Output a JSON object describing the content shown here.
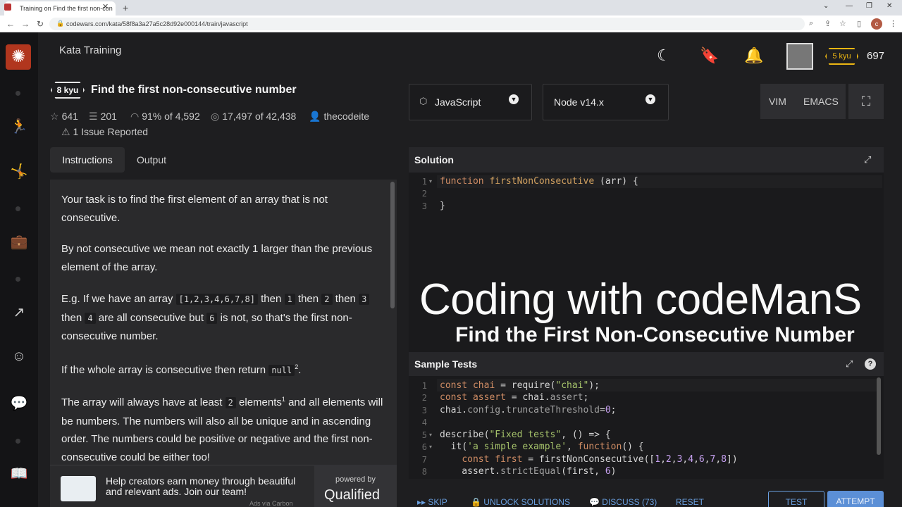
{
  "browser": {
    "tab_title": "Training on Find the first non-con",
    "url": "codewars.com/kata/58f8a3a27a5c28d92e000144/train/javascript",
    "profile_initial": "c"
  },
  "header": {
    "section": "Kata Training",
    "kyu": "5 kyu",
    "honor": "697"
  },
  "kata": {
    "rank": "8 kyu",
    "title": "Find the first non-consecutive number",
    "stars": "641",
    "collections": "201",
    "satisfaction": "91%",
    "satisfaction_of": "of 4,592",
    "completed": "17,497",
    "completed_of": "of 42,438",
    "author": "thecodeite",
    "issues": "1 Issue Reported"
  },
  "tabs": {
    "instructions": "Instructions",
    "output": "Output"
  },
  "instructions": {
    "p1": "Your task is to find the first element of an array that is not consecutive.",
    "p2": "By not consecutive we mean not exactly 1 larger than the previous element of the array.",
    "p3_a": "E.g. If we have an array",
    "p3_code1": "[1,2,3,4,6,7,8]",
    "p3_b": "then",
    "p3_code2": "1",
    "p3_c": "then",
    "p3_code3": "2",
    "p3_d": "then",
    "p3_code4": "3",
    "p3_e": "then",
    "p3_code5": "4",
    "p3_f": "are all consecutive but",
    "p3_code6": "6",
    "p3_g": "is not, so that's the first non-consecutive number.",
    "p4_a": "If the whole array is consecutive then return",
    "p4_code": "null",
    "p4_sup": "2",
    "p4_b": ".",
    "p5_a": "The array will always have at least",
    "p5_code": "2",
    "p5_b": "elements",
    "p5_sup": "1",
    "p5_c": "and all elements will be numbers. The numbers will also all be unique and in ascending order. The numbers could be positive or negative and the first non-consecutive could be either too!"
  },
  "ad": {
    "text": "Help creators earn money through beautiful and relevant ads. Join our team!",
    "carbon": "Ads via Carbon",
    "powered_by": "powered by",
    "brand": "Qualified"
  },
  "toolbar": {
    "language": "JavaScript",
    "runtime": "Node v14.x",
    "vim": "VIM",
    "emacs": "EMACS"
  },
  "solution": {
    "label": "Solution",
    "lines": [
      {
        "n": "1",
        "kw": "function",
        "fn": "firstNonConsecutive",
        "rest": " (arr) {"
      },
      {
        "n": "2",
        "text": ""
      },
      {
        "n": "3",
        "text": "}"
      }
    ]
  },
  "overlay": {
    "main": "Coding with codeManS",
    "sub": "Find the First Non-Consecutive Number"
  },
  "tests": {
    "label": "Sample Tests",
    "line_numbers": [
      "1",
      "2",
      "3",
      "4",
      "5",
      "6",
      "7",
      "8"
    ]
  },
  "bottom": {
    "skip": "SKIP",
    "unlock": "UNLOCK SOLUTIONS",
    "discuss": "DISCUSS (73)",
    "reset": "RESET",
    "test": "TEST",
    "attempt": "ATTEMPT"
  }
}
